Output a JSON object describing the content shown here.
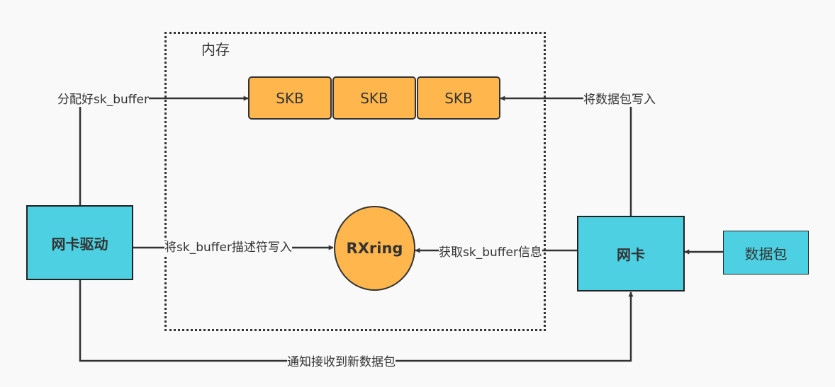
{
  "memory": {
    "title": "内存"
  },
  "nodes": {
    "driver": "网卡驱动",
    "nic": "网卡",
    "packet": "数据包",
    "rxring": "RXring",
    "skb": [
      "SKB",
      "SKB",
      "SKB"
    ]
  },
  "edges": {
    "allocate": "分配好sk_buffer",
    "write_packet": "将数据包写入",
    "write_descriptor": "将sk_buffer描述符写入",
    "fetch_info": "获取sk_buffer信息",
    "notify": "通知接收到新数据包"
  },
  "colors": {
    "cyan": "#4dd0e1",
    "orange": "#ffb74d",
    "line": "#333333"
  }
}
